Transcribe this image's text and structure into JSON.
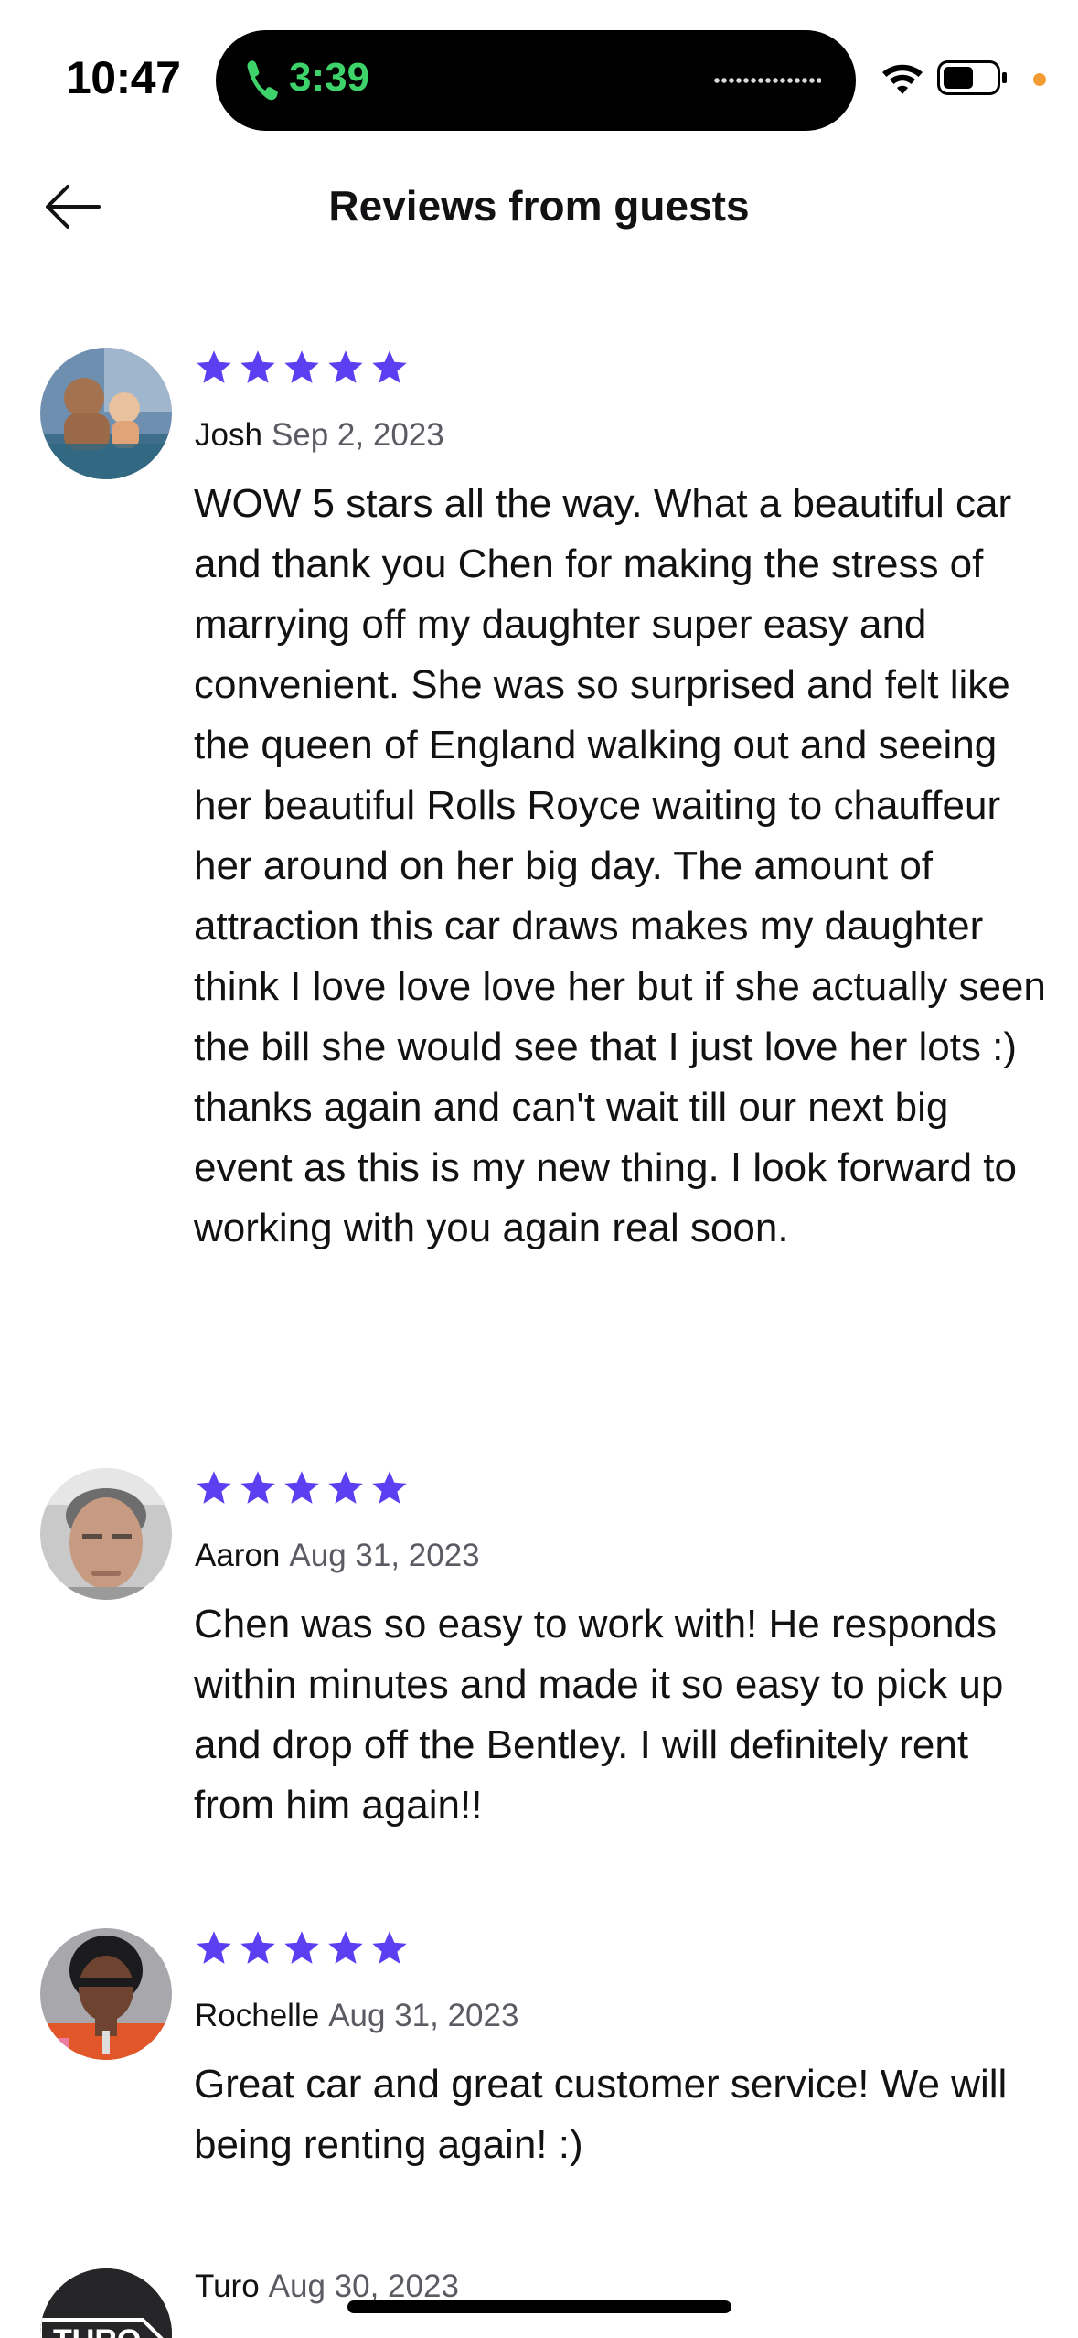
{
  "status_bar": {
    "time": "10:47",
    "call_timer": "3:39",
    "icons": [
      "phone-icon",
      "wifi-icon",
      "battery-icon"
    ],
    "call_color": "#3ed36a"
  },
  "header": {
    "title": "Reviews from guests",
    "back_icon": "arrow-left-icon"
  },
  "accent_color": "#5b3ff0",
  "reviews": [
    {
      "name": "Josh",
      "date": "Sep 2, 2023",
      "rating": 5,
      "text": "WOW 5 stars all the way. What a beautiful car and thank you Chen for making the stress of marrying off my daughter super easy and convenient. She was so surprised and felt like the queen of England walking out and seeing her beautiful Rolls Royce waiting to chauffeur her around on her big day. The amount of attraction this car draws makes my daughter think I love love love her but if she actually seen the bill she would see that I just love her lots :) thanks again and can't wait till our next big event as this is my new thing. I look forward to working with you again real soon."
    },
    {
      "name": "Aaron",
      "date": "Aug 31, 2023",
      "rating": 5,
      "text": "Chen was so easy to work with! He responds within minutes and made it so easy to pick up and drop off the Bentley. I will definitely rent from him again!!"
    },
    {
      "name": "Rochelle",
      "date": "Aug 31, 2023",
      "rating": 5,
      "text": "Great car and great customer service! We will being renting again! :)"
    },
    {
      "name": "Turo",
      "date": "Aug 30, 2023",
      "avatar_text": "TURO"
    }
  ]
}
